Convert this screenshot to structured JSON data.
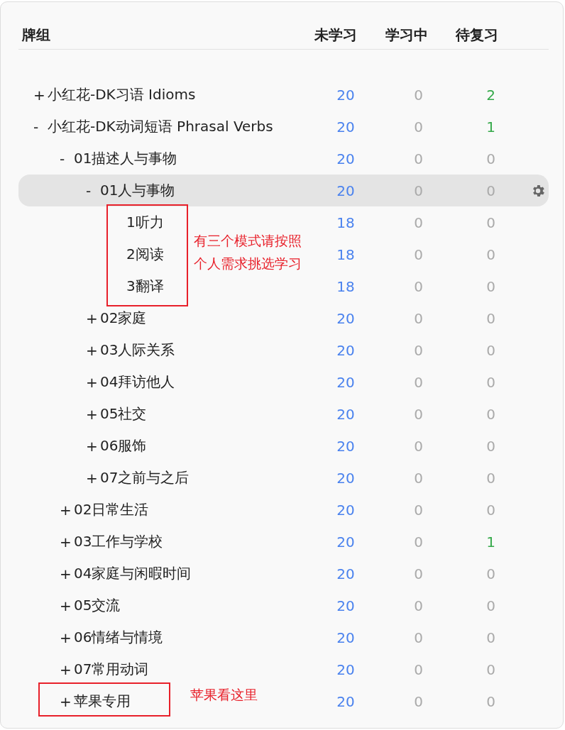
{
  "columns": [
    "牌组",
    "未学习",
    "学习中",
    "待复习"
  ],
  "decks": [
    {
      "toggle": "+",
      "name": "小红花-DK习语 Idioms",
      "new": "20",
      "learning": "0",
      "review": "2",
      "selected": false
    },
    {
      "toggle": "-",
      "name": "小红花-DK动词短语 Phrasal Verbs",
      "new": "20",
      "learning": "0",
      "review": "1",
      "selected": false,
      "children": [
        {
          "toggle": "-",
          "name": "01描述人与事物",
          "new": "20",
          "learning": "0",
          "review": "0",
          "selected": false,
          "children": [
            {
              "toggle": "-",
              "name": "01人与事物",
              "new": "20",
              "learning": "0",
              "review": "0",
              "selected": true,
              "children": [
                {
                  "name": "1听力",
                  "new": "18",
                  "learning": "0",
                  "review": "0",
                  "selected": false
                },
                {
                  "name": "2阅读",
                  "new": "18",
                  "learning": "0",
                  "review": "0",
                  "selected": false
                },
                {
                  "name": "3翻译",
                  "new": "18",
                  "learning": "0",
                  "review": "0",
                  "selected": false
                }
              ]
            },
            {
              "toggle": "+",
              "name": "02家庭",
              "new": "20",
              "learning": "0",
              "review": "0",
              "selected": false
            },
            {
              "toggle": "+",
              "name": "03人际关系",
              "new": "20",
              "learning": "0",
              "review": "0",
              "selected": false
            },
            {
              "toggle": "+",
              "name": "04拜访他人",
              "new": "20",
              "learning": "0",
              "review": "0",
              "selected": false
            },
            {
              "toggle": "+",
              "name": "05社交",
              "new": "20",
              "learning": "0",
              "review": "0",
              "selected": false
            },
            {
              "toggle": "+",
              "name": "06服饰",
              "new": "20",
              "learning": "0",
              "review": "0",
              "selected": false
            },
            {
              "toggle": "+",
              "name": "07之前与之后",
              "new": "20",
              "learning": "0",
              "review": "0",
              "selected": false
            }
          ]
        },
        {
          "toggle": "+",
          "name": "02日常生活",
          "new": "20",
          "learning": "0",
          "review": "0",
          "selected": false
        },
        {
          "toggle": "+",
          "name": "03工作与学校",
          "new": "20",
          "learning": "0",
          "review": "1",
          "selected": false
        },
        {
          "toggle": "+",
          "name": "04家庭与闲暇时间",
          "new": "20",
          "learning": "0",
          "review": "0",
          "selected": false
        },
        {
          "toggle": "+",
          "name": "05交流",
          "new": "20",
          "learning": "0",
          "review": "0",
          "selected": false
        },
        {
          "toggle": "+",
          "name": "06情绪与情境",
          "new": "20",
          "learning": "0",
          "review": "0",
          "selected": false
        },
        {
          "toggle": "+",
          "name": "07常用动词",
          "new": "20",
          "learning": "0",
          "review": "0",
          "selected": false
        },
        {
          "toggle": "+",
          "name": "苹果专用",
          "new": "20",
          "learning": "0",
          "review": "0",
          "selected": false
        }
      ]
    }
  ],
  "annotations": [
    {
      "text": "有三个模式请按照个人需求挑选学习"
    },
    {
      "text": "苹果看这里"
    }
  ]
}
